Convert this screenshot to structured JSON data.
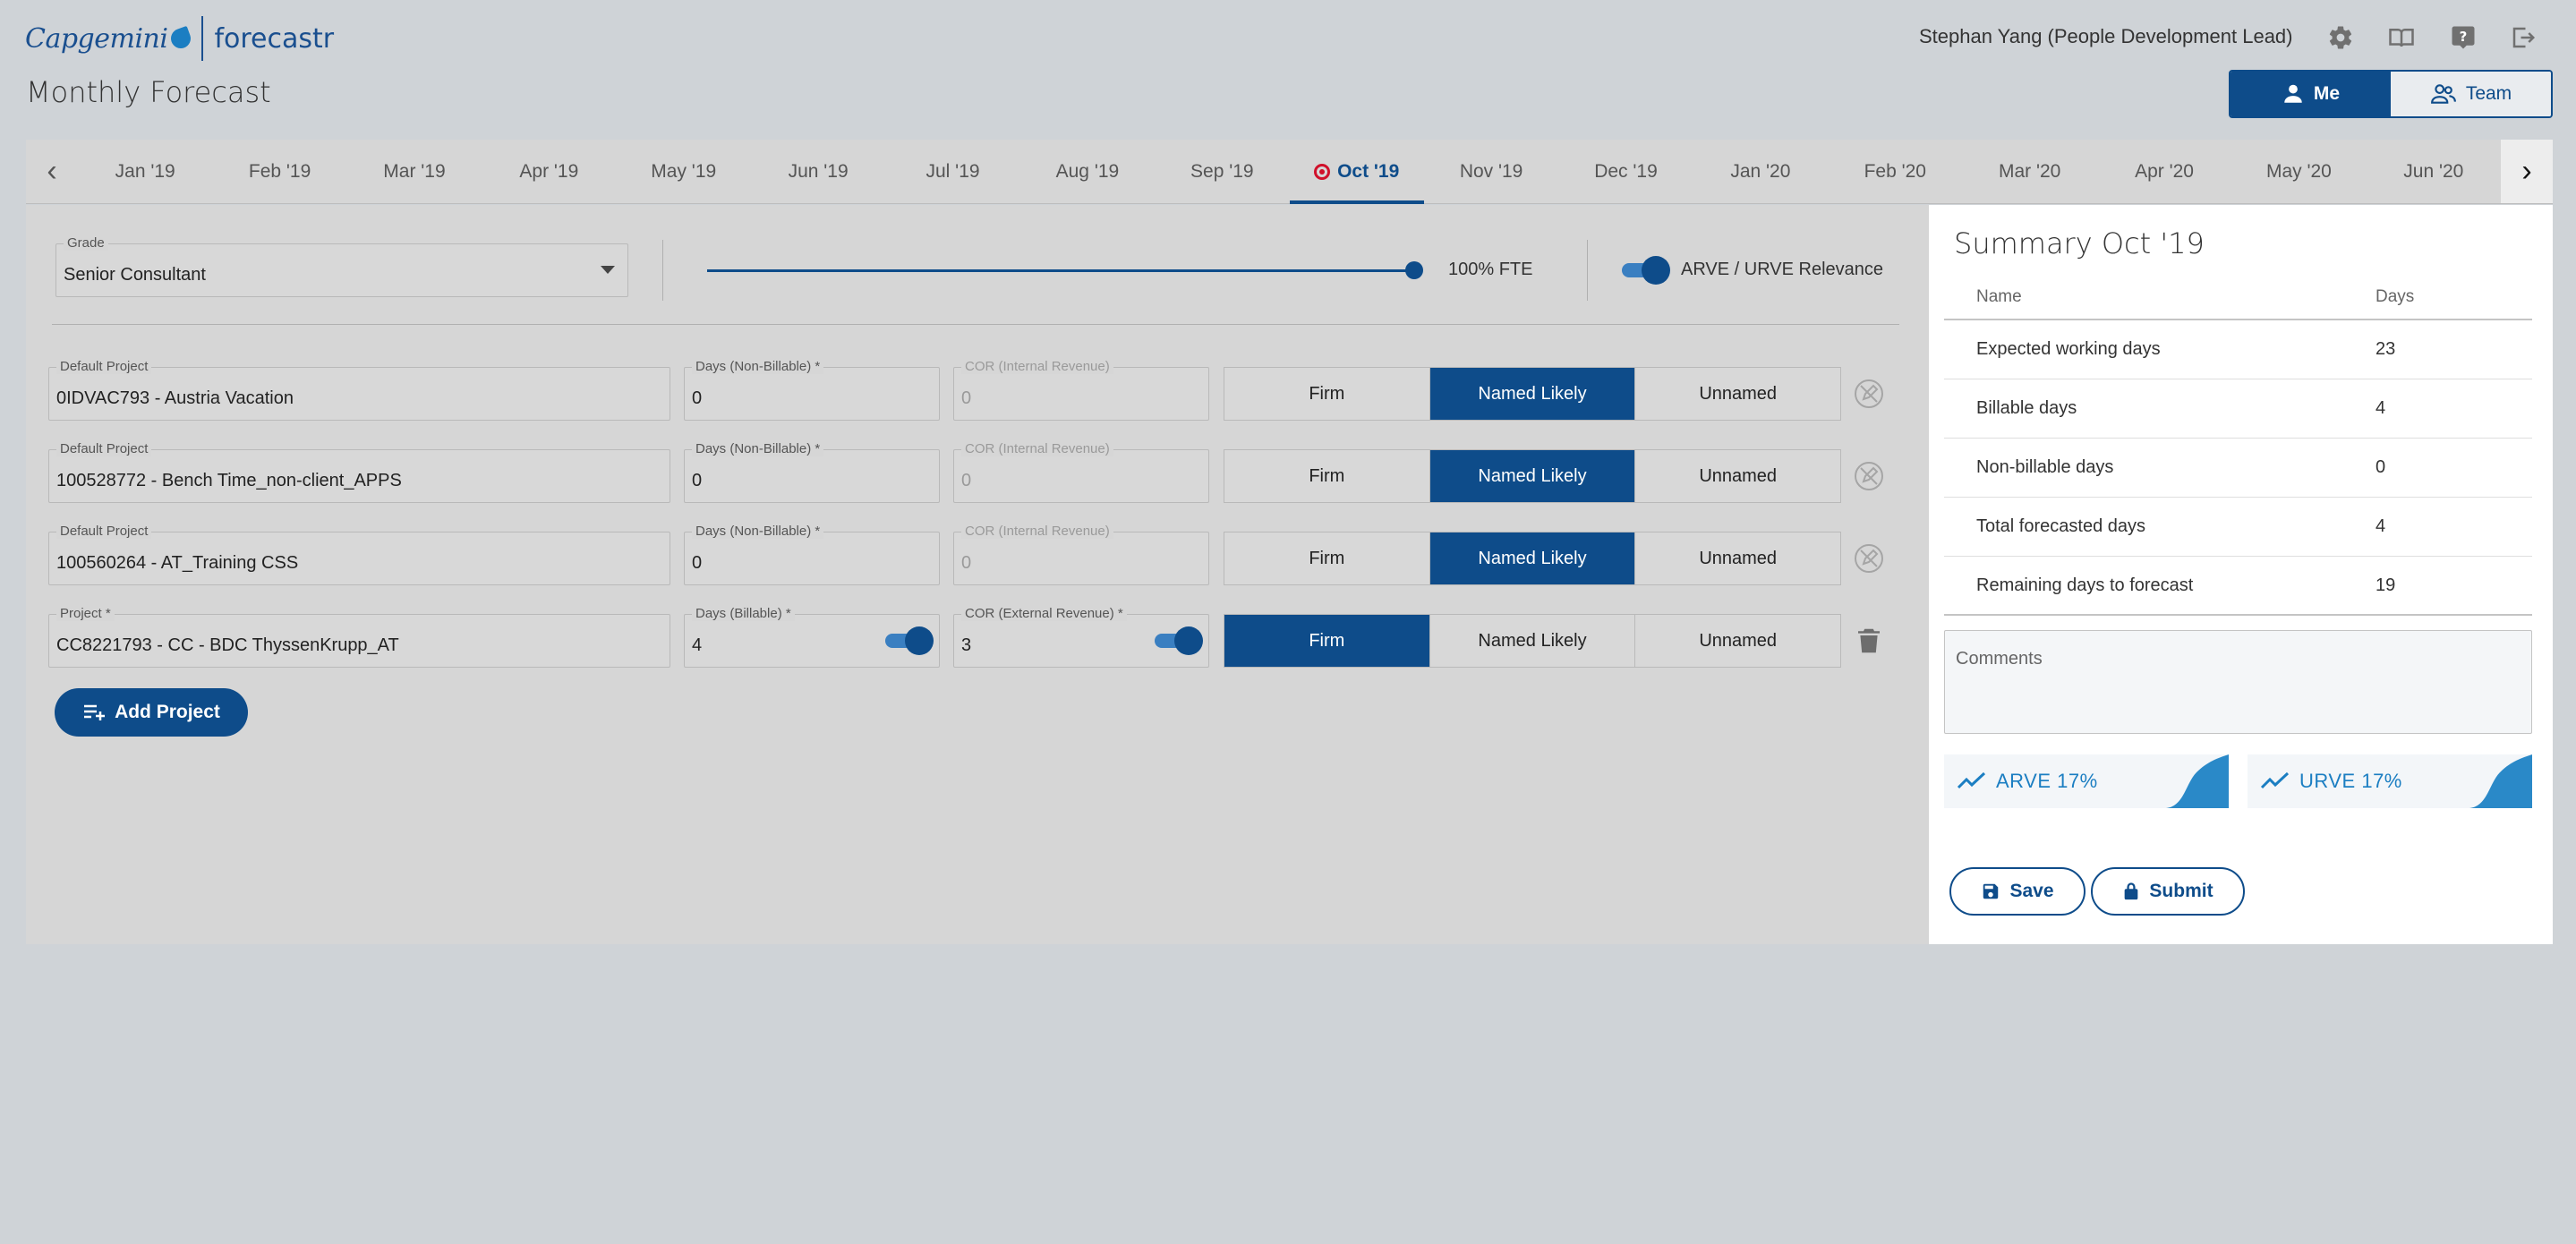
{
  "header": {
    "brand": "Capgemini",
    "product": "forecastr",
    "user": "Stephan Yang (People Development Lead)",
    "icons": [
      "gear-icon",
      "book-icon",
      "help-icon",
      "logout-icon"
    ]
  },
  "page_title": "Monthly Forecast",
  "view_toggle": {
    "me": "Me",
    "team": "Team",
    "selected": "Me"
  },
  "months": [
    "Jan '19",
    "Feb '19",
    "Mar '19",
    "Apr '19",
    "May '19",
    "Jun '19",
    "Jul '19",
    "Aug '19",
    "Sep '19",
    "Oct '19",
    "Nov '19",
    "Dec '19",
    "Jan '20",
    "Feb '20",
    "Mar '20",
    "Apr '20",
    "May '20",
    "Jun '20"
  ],
  "active_month": "Oct '19",
  "controls": {
    "grade_label": "Grade",
    "grade_value": "Senior Consultant",
    "fte_value": 1.0,
    "fte_label": "100% FTE",
    "relevance_label": "ARVE / URVE Relevance",
    "relevance_on": true
  },
  "projects": [
    {
      "project_label": "Default Project",
      "project_value": "0IDVAC793 - Austria Vacation",
      "days_label": "Days (Non-Billable) *",
      "days_value": "0",
      "cor_label": "COR (Internal Revenue)",
      "cor_value": "0",
      "status_options": [
        "Firm",
        "Named Likely",
        "Unnamed"
      ],
      "selected": "Named Likely"
    },
    {
      "project_label": "Default Project",
      "project_value": "100528772 - Bench Time_non-client_APPS",
      "days_label": "Days (Non-Billable) *",
      "days_value": "0",
      "cor_label": "COR (Internal Revenue)",
      "cor_value": "0",
      "status_options": [
        "Firm",
        "Named Likely",
        "Unnamed"
      ],
      "selected": "Named Likely"
    },
    {
      "project_label": "Default Project",
      "project_value": "100560264 - AT_Training CSS",
      "days_label": "Days (Non-Billable) *",
      "days_value": "0",
      "cor_label": "COR (Internal Revenue)",
      "cor_value": "0",
      "status_options": [
        "Firm",
        "Named Likely",
        "Unnamed"
      ],
      "selected": "Named Likely"
    },
    {
      "project_label": "Project *",
      "project_value": "CC8221793 - CC - BDC ThyssenKrupp_AT",
      "days_label": "Days (Billable) *",
      "days_value": "4",
      "cor_label": "COR (External Revenue) *",
      "cor_value": "3",
      "status_options": [
        "Firm",
        "Named Likely",
        "Unnamed"
      ],
      "selected": "Firm"
    }
  ],
  "add_project_label": "Add Project",
  "summary": {
    "title": "Summary Oct '19",
    "col_name": "Name",
    "col_days": "Days",
    "rows": [
      {
        "name": "Expected working days",
        "days": "23"
      },
      {
        "name": "Billable days",
        "days": "4"
      },
      {
        "name": "Non-billable days",
        "days": "0"
      },
      {
        "name": "Total forecasted days",
        "days": "4"
      },
      {
        "name": "Remaining days to forecast",
        "days": "19"
      }
    ],
    "comments_placeholder": "Comments",
    "arve": "ARVE 17%",
    "urve": "URVE 17%",
    "save": "Save",
    "submit": "Submit"
  },
  "colors": {
    "primary": "#0e4c8a",
    "accent": "#1b7ec2",
    "alert": "#d0112b"
  }
}
